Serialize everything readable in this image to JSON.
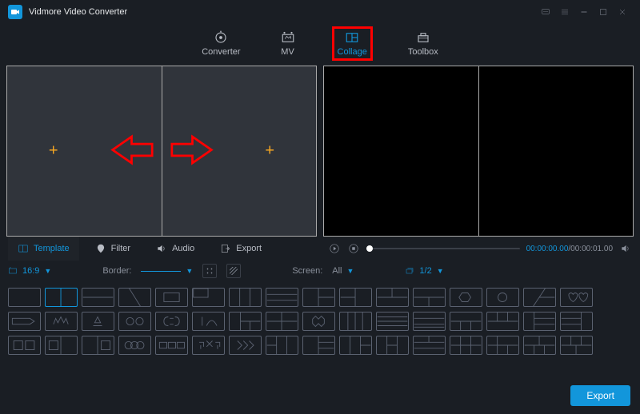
{
  "app": {
    "title": "Vidmore Video Converter"
  },
  "nav": {
    "converter": "Converter",
    "mv": "MV",
    "collage": "Collage",
    "toolbox": "Toolbox"
  },
  "tabs": {
    "template": "Template",
    "filter": "Filter",
    "audio": "Audio",
    "export": "Export"
  },
  "options": {
    "aspect": "16:9",
    "border_label": "Border:",
    "screen_label": "Screen:",
    "screen_value": "All",
    "page": "1/2"
  },
  "player": {
    "current": "00:00:00.00",
    "total": "00:00:01.00"
  },
  "footer": {
    "export": "Export"
  }
}
